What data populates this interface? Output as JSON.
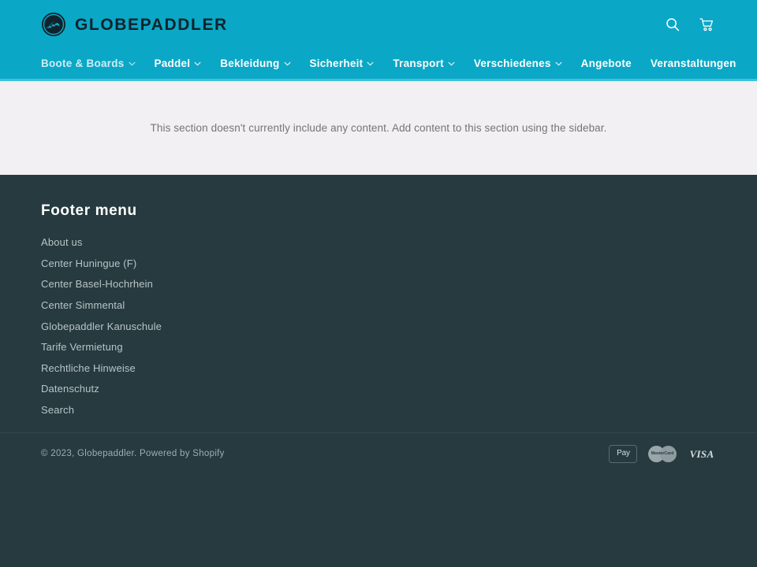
{
  "header": {
    "brand_name": "GLOBEPADDLER",
    "logo_icon": "globe-wave-icon",
    "search_icon": "search-icon",
    "cart_icon": "cart-icon"
  },
  "nav": {
    "items": [
      {
        "label": "Boote & Boards",
        "has_dropdown": true,
        "dimmed": true
      },
      {
        "label": "Paddel",
        "has_dropdown": true,
        "dimmed": false
      },
      {
        "label": "Bekleidung",
        "has_dropdown": true,
        "dimmed": false
      },
      {
        "label": "Sicherheit",
        "has_dropdown": true,
        "dimmed": false
      },
      {
        "label": "Transport",
        "has_dropdown": true,
        "dimmed": false
      },
      {
        "label": "Verschiedenes",
        "has_dropdown": true,
        "dimmed": false
      },
      {
        "label": "Angebote",
        "has_dropdown": false,
        "dimmed": false
      },
      {
        "label": "Veranstaltungen",
        "has_dropdown": false,
        "dimmed": false
      }
    ]
  },
  "main": {
    "empty_message": "This section doesn't currently include any content. Add content to this section using the sidebar."
  },
  "footer": {
    "title": "Footer menu",
    "links": [
      "About us",
      "Center Huningue (F)",
      "Center Basel-Hochrhein",
      "Center Simmental",
      "Globepaddler Kanuschule",
      "Tarife Vermietung",
      "Rechtliche Hinweise",
      "Datenschutz",
      "Search"
    ]
  },
  "bottom": {
    "copyright": "© 2023, Globepaddler. Powered by Shopify",
    "payment_methods": [
      {
        "name": "apple-pay",
        "logo_glyph": "",
        "label": "Pay"
      },
      {
        "name": "mastercard",
        "label": "MasterCard"
      },
      {
        "name": "visa",
        "label": "VISA"
      }
    ]
  },
  "colors": {
    "brand_cyan": "#0ba7c6",
    "nav_border": "#3fc2d8",
    "content_bg": "#f2f0f2",
    "footer_bg": "#263a3f",
    "logo_dark": "#10232b"
  }
}
